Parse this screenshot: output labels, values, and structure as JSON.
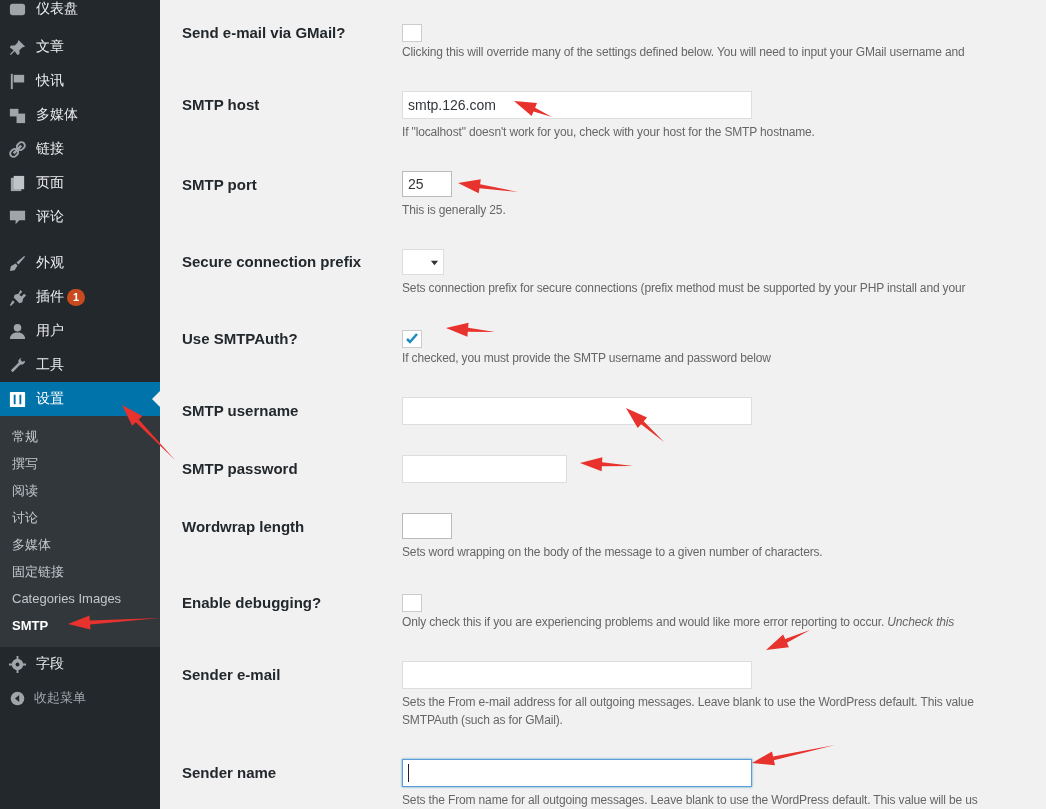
{
  "sidebar": {
    "groups": [
      [
        {
          "label": "仪表盘",
          "selected": false
        }
      ],
      [
        {
          "label": "文章",
          "selected": false
        },
        {
          "label": "快讯",
          "selected": false
        },
        {
          "label": "多媒体",
          "selected": false
        },
        {
          "label": "链接",
          "selected": false
        },
        {
          "label": "页面",
          "selected": false
        },
        {
          "label": "评论",
          "selected": false
        }
      ],
      [
        {
          "label": "外观",
          "selected": false
        },
        {
          "label": "插件",
          "selected": false,
          "badge": "1"
        },
        {
          "label": "用户",
          "selected": false
        },
        {
          "label": "工具",
          "selected": false
        },
        {
          "label": "设置",
          "selected": true,
          "submenu": [
            {
              "label": "常规",
              "selected": false
            },
            {
              "label": "撰写",
              "selected": false
            },
            {
              "label": "阅读",
              "selected": false
            },
            {
              "label": "讨论",
              "selected": false
            },
            {
              "label": "多媒体",
              "selected": false
            },
            {
              "label": "固定链接",
              "selected": false
            },
            {
              "label": "Categories Images",
              "selected": false
            },
            {
              "label": "SMTP",
              "selected": true
            }
          ]
        },
        {
          "label": "字段",
          "selected": false
        }
      ]
    ],
    "collapse_button": "收起菜单"
  },
  "settings": [
    {
      "label": "Send e-mail via GMail?",
      "kind": "checkbox",
      "checked": false,
      "description": [
        "Clicking this will override many of the settings defined below. You will need to input your GMail username and"
      ]
    },
    {
      "label": "SMTP host",
      "kind": "text",
      "value": "smtp.126.com",
      "focused": false,
      "description": [
        "If \"localhost\" doesn't work for you, check with your host for the SMTP hostname."
      ]
    },
    {
      "label": "SMTP port",
      "kind": "number",
      "value": "25",
      "focused": false,
      "description": [
        "This is generally 25."
      ]
    },
    {
      "label": "Secure connection prefix",
      "kind": "select",
      "description": [
        "Sets connection prefix for secure connections (prefix method must be supported by your PHP install and your"
      ]
    },
    {
      "label": "Use SMTPAuth?",
      "kind": "checkbox",
      "checked": true,
      "description": [
        "If checked, you must provide the SMTP username and password below"
      ]
    },
    {
      "label": "SMTP username",
      "kind": "text",
      "focused": false
    },
    {
      "label": "SMTP password",
      "kind": "password",
      "focused": false
    },
    {
      "label": "Wordwrap length",
      "kind": "number",
      "focused": false,
      "description": [
        "Sets word wrapping on the body of the message to a given number of characters."
      ]
    },
    {
      "label": "Enable debugging?",
      "kind": "checkbox",
      "checked": false,
      "description": [
        "Only check this if you are experiencing problems and would like more error reporting to occur. *Uncheck this*"
      ]
    },
    {
      "label": "Sender e-mail",
      "kind": "text",
      "focused": false,
      "description": [
        "Sets the From e-mail address for all outgoing messages. Leave blank to use the WordPress default. This value",
        "SMTPAuth (such as for GMail)."
      ]
    },
    {
      "label": "Sender name",
      "kind": "text",
      "focused": true,
      "description": [
        "Sets the From name for all outgoing messages. Leave blank to use the WordPress default. This value will be us"
      ]
    }
  ]
}
